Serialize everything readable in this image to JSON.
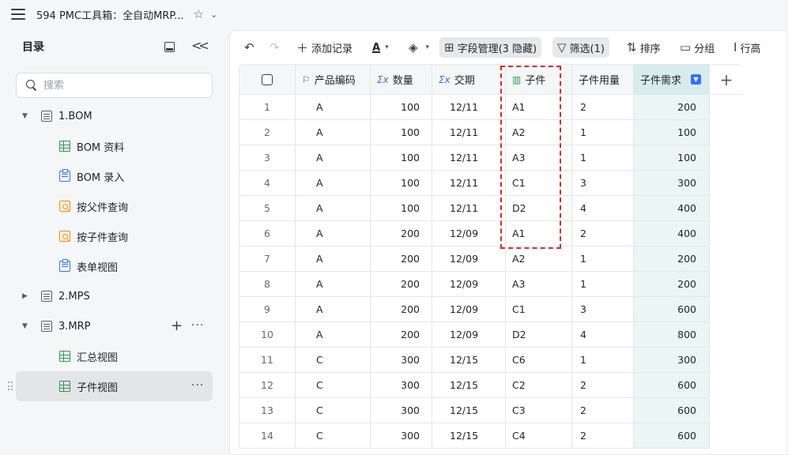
{
  "window": {
    "title": "594 PMC工具箱：全自动MRP..."
  },
  "sidebar": {
    "title": "目录",
    "search_placeholder": "搜索",
    "nodes": [
      {
        "label": "1.BOM",
        "level": 0,
        "icon": "list-icon",
        "expanded": true
      },
      {
        "label": "BOM 资料",
        "level": 1,
        "icon": "grid-view-icon"
      },
      {
        "label": "BOM 录入",
        "level": 1,
        "icon": "form-icon"
      },
      {
        "label": "按父件查询",
        "level": 1,
        "icon": "query-icon"
      },
      {
        "label": "按子件查询",
        "level": 1,
        "icon": "query-icon"
      },
      {
        "label": "表单视图",
        "level": 1,
        "icon": "form-icon"
      },
      {
        "label": "2.MPS",
        "level": 0,
        "icon": "list-icon",
        "expanded": false
      },
      {
        "label": "3.MRP",
        "level": 0,
        "icon": "list-icon",
        "expanded": true
      },
      {
        "label": "汇总视图",
        "level": 1,
        "icon": "grid-view-icon"
      },
      {
        "label": "子件视图",
        "level": 1,
        "icon": "grid-view-icon",
        "active": true
      }
    ]
  },
  "toolbar": {
    "add_record": "添加记录",
    "field_manage": "字段管理(3 隐藏)",
    "filter": "筛选(1)",
    "sort": "排序",
    "group": "分组",
    "row_height": "行高",
    "text_color_glyph": "A"
  },
  "table": {
    "columns": [
      "产品编码",
      "数量",
      "交期",
      "子件",
      "子件用量",
      "子件需求"
    ],
    "rows": [
      [
        "1",
        "A",
        "100",
        "12/11",
        "A1",
        "2",
        "200"
      ],
      [
        "2",
        "A",
        "100",
        "12/11",
        "A2",
        "1",
        "100"
      ],
      [
        "3",
        "A",
        "100",
        "12/11",
        "A3",
        "1",
        "100"
      ],
      [
        "4",
        "A",
        "100",
        "12/11",
        "C1",
        "3",
        "300"
      ],
      [
        "5",
        "A",
        "100",
        "12/11",
        "D2",
        "4",
        "400"
      ],
      [
        "6",
        "A",
        "200",
        "12/09",
        "A1",
        "2",
        "400"
      ],
      [
        "7",
        "A",
        "200",
        "12/09",
        "A2",
        "1",
        "200"
      ],
      [
        "8",
        "A",
        "200",
        "12/09",
        "A3",
        "1",
        "200"
      ],
      [
        "9",
        "A",
        "200",
        "12/09",
        "C1",
        "3",
        "600"
      ],
      [
        "10",
        "A",
        "200",
        "12/09",
        "D2",
        "4",
        "800"
      ],
      [
        "11",
        "C",
        "300",
        "12/15",
        "C6",
        "1",
        "300"
      ],
      [
        "12",
        "C",
        "300",
        "12/15",
        "C2",
        "2",
        "600"
      ],
      [
        "13",
        "C",
        "300",
        "12/15",
        "C3",
        "2",
        "600"
      ],
      [
        "14",
        "C",
        "300",
        "12/15",
        "C4",
        "2",
        "600"
      ]
    ]
  },
  "colors": {
    "accent": "#3370ff",
    "highlight_column": "#eaf5f5",
    "annotation": "#d92b1f"
  }
}
